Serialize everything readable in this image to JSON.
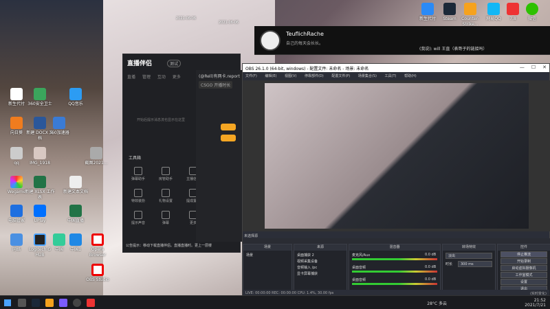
{
  "desktop": {
    "top_dates": [
      "2021-06-06",
      "2021-06-06"
    ],
    "top_right_icons": [
      "新生代付",
      "Steam",
      "Counter-Strike...",
      "网易QQ",
      "7.8",
      "微信"
    ],
    "left_icons": [
      "新生代付",
      "360安全卫士",
      "QQ音乐",
      "向日葵",
      "新建 DOCX 文档",
      "360加速器",
      "qq",
      "IMG_1918",
      "截图2021...",
      "Wegame",
      "新建 XLSX 工作表",
      "新建文本文档",
      "电脑管家",
      "UPlay",
      "中国直播",
      "网络",
      "Logitech G HUB",
      "中国",
      "中国1",
      "Opera Browser",
      "OBS Studio"
    ]
  },
  "banner": {
    "name": "TeuflichRache",
    "subtitle": "自己的每天会长长。",
    "chat": "(我说): will 王直（表哥子的链接吗）"
  },
  "stream_app": {
    "logo": "直播伴侣",
    "version": "测试",
    "tabs": [
      "直播",
      "管理",
      "互动",
      "更多"
    ],
    "empty_hint": "开始后提示消息流也显示在这里",
    "tools_title": "工具箱",
    "tools": [
      "弹幕助手",
      "房管助手",
      "主播信息",
      "特效装扮",
      "礼物设置",
      "提成置顶",
      "提示声音",
      "弹幕",
      "更多"
    ],
    "status": "公告提示：移动下载直播伴侣。直播直播时。更上一层楼"
  },
  "app2": {
    "title": "(@Rell)有两卡.report",
    "chip": "CSGO  开播时长"
  },
  "obs": {
    "title": "OBS 26.1.0 (64-bit, windows) - 配置文件: 未命名 - 场景: 未命名",
    "menu": [
      "文件(F)",
      "编辑(E)",
      "视图(V)",
      "停靠部件(D)",
      "配置文件(P)",
      "场景集合(S)",
      "工具(T)",
      "帮助(H)"
    ],
    "scene_selected": "未选择源",
    "scenes_header": "场景",
    "scenes": [
      "场景"
    ],
    "sources_header": "来源",
    "sources": [
      "桌面捕获 2",
      "视频采集设备",
      "音频输入 /pc",
      "显卡屏幕捕获"
    ],
    "mixer_header": "混音器",
    "mixer": [
      {
        "name": "麦克风/Aux",
        "db": "0.0 dB"
      },
      {
        "name": "桌面音频",
        "db": "0.0 dB"
      },
      {
        "name": "桌面音频",
        "db": "0.0 dB"
      }
    ],
    "transitions_header": "转场特效",
    "transition": "淡出",
    "duration_label": "时长",
    "duration": "300 ms",
    "controls_header": "控件",
    "controls": [
      "停止推流",
      "开始录制",
      "启动虚拟摄像机",
      "工作室模式",
      "设置",
      "退出"
    ],
    "status": "LIVE: 00:00:00  REC: 00:00:00  CPU: 1.4%, 30.00 fps",
    "footer_chip": "(实时变化)"
  },
  "taskbar": {
    "temp": "28°C 多云",
    "time": "21:52",
    "date": "2021/7/21"
  },
  "colors": {
    "accent": "#f5a623",
    "obs_bg": "#2b2e38"
  }
}
